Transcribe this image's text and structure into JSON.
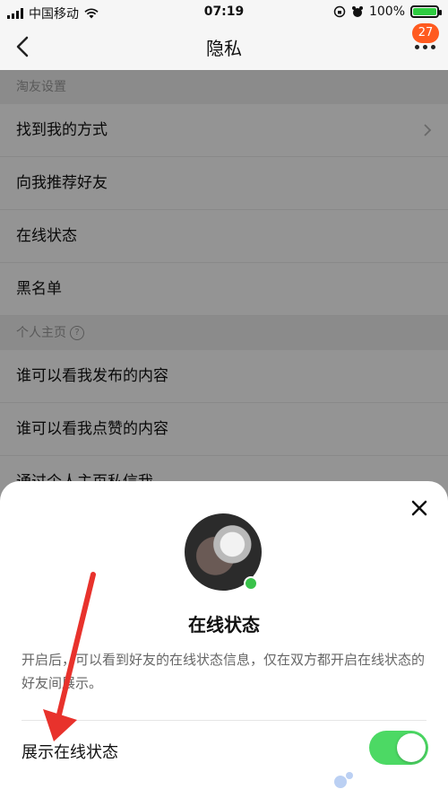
{
  "status_bar": {
    "carrier": "中国移动",
    "time": "07:19",
    "battery": "100%"
  },
  "nav": {
    "title": "隐私",
    "badge": "27"
  },
  "sections": [
    {
      "header": "淘友设置",
      "items": [
        "找到我的方式",
        "向我推荐好友",
        "在线状态",
        "黑名单"
      ]
    },
    {
      "header": "个人主页",
      "items": [
        "谁可以看我发布的内容",
        "谁可以看我点赞的内容",
        "通过个人主页私信我"
      ]
    }
  ],
  "sheet": {
    "title": "在线状态",
    "description": "开启后，可以看到好友的在线状态信息，仅在双方都开启在线状态的好友间展示。",
    "toggle_label": "展示在线状态",
    "toggle_on": true
  },
  "colors": {
    "accent_green": "#4cd964",
    "online_dot": "#39c24a",
    "badge": "#ff5a1f",
    "annotation_red": "#e8322c"
  }
}
